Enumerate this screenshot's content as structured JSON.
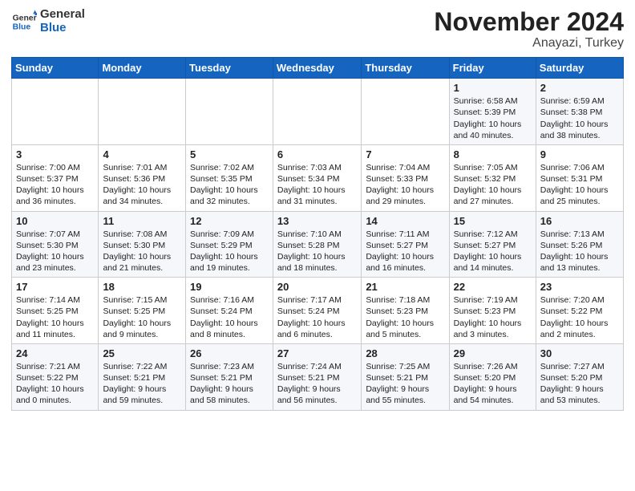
{
  "header": {
    "logo_general": "General",
    "logo_blue": "Blue",
    "title": "November 2024",
    "subtitle": "Anayazi, Turkey"
  },
  "days_of_week": [
    "Sunday",
    "Monday",
    "Tuesday",
    "Wednesday",
    "Thursday",
    "Friday",
    "Saturday"
  ],
  "weeks": [
    [
      {
        "day": "",
        "info": ""
      },
      {
        "day": "",
        "info": ""
      },
      {
        "day": "",
        "info": ""
      },
      {
        "day": "",
        "info": ""
      },
      {
        "day": "",
        "info": ""
      },
      {
        "day": "1",
        "info": "Sunrise: 6:58 AM\nSunset: 5:39 PM\nDaylight: 10 hours\nand 40 minutes."
      },
      {
        "day": "2",
        "info": "Sunrise: 6:59 AM\nSunset: 5:38 PM\nDaylight: 10 hours\nand 38 minutes."
      }
    ],
    [
      {
        "day": "3",
        "info": "Sunrise: 7:00 AM\nSunset: 5:37 PM\nDaylight: 10 hours\nand 36 minutes."
      },
      {
        "day": "4",
        "info": "Sunrise: 7:01 AM\nSunset: 5:36 PM\nDaylight: 10 hours\nand 34 minutes."
      },
      {
        "day": "5",
        "info": "Sunrise: 7:02 AM\nSunset: 5:35 PM\nDaylight: 10 hours\nand 32 minutes."
      },
      {
        "day": "6",
        "info": "Sunrise: 7:03 AM\nSunset: 5:34 PM\nDaylight: 10 hours\nand 31 minutes."
      },
      {
        "day": "7",
        "info": "Sunrise: 7:04 AM\nSunset: 5:33 PM\nDaylight: 10 hours\nand 29 minutes."
      },
      {
        "day": "8",
        "info": "Sunrise: 7:05 AM\nSunset: 5:32 PM\nDaylight: 10 hours\nand 27 minutes."
      },
      {
        "day": "9",
        "info": "Sunrise: 7:06 AM\nSunset: 5:31 PM\nDaylight: 10 hours\nand 25 minutes."
      }
    ],
    [
      {
        "day": "10",
        "info": "Sunrise: 7:07 AM\nSunset: 5:30 PM\nDaylight: 10 hours\nand 23 minutes."
      },
      {
        "day": "11",
        "info": "Sunrise: 7:08 AM\nSunset: 5:30 PM\nDaylight: 10 hours\nand 21 minutes."
      },
      {
        "day": "12",
        "info": "Sunrise: 7:09 AM\nSunset: 5:29 PM\nDaylight: 10 hours\nand 19 minutes."
      },
      {
        "day": "13",
        "info": "Sunrise: 7:10 AM\nSunset: 5:28 PM\nDaylight: 10 hours\nand 18 minutes."
      },
      {
        "day": "14",
        "info": "Sunrise: 7:11 AM\nSunset: 5:27 PM\nDaylight: 10 hours\nand 16 minutes."
      },
      {
        "day": "15",
        "info": "Sunrise: 7:12 AM\nSunset: 5:27 PM\nDaylight: 10 hours\nand 14 minutes."
      },
      {
        "day": "16",
        "info": "Sunrise: 7:13 AM\nSunset: 5:26 PM\nDaylight: 10 hours\nand 13 minutes."
      }
    ],
    [
      {
        "day": "17",
        "info": "Sunrise: 7:14 AM\nSunset: 5:25 PM\nDaylight: 10 hours\nand 11 minutes."
      },
      {
        "day": "18",
        "info": "Sunrise: 7:15 AM\nSunset: 5:25 PM\nDaylight: 10 hours\nand 9 minutes."
      },
      {
        "day": "19",
        "info": "Sunrise: 7:16 AM\nSunset: 5:24 PM\nDaylight: 10 hours\nand 8 minutes."
      },
      {
        "day": "20",
        "info": "Sunrise: 7:17 AM\nSunset: 5:24 PM\nDaylight: 10 hours\nand 6 minutes."
      },
      {
        "day": "21",
        "info": "Sunrise: 7:18 AM\nSunset: 5:23 PM\nDaylight: 10 hours\nand 5 minutes."
      },
      {
        "day": "22",
        "info": "Sunrise: 7:19 AM\nSunset: 5:23 PM\nDaylight: 10 hours\nand 3 minutes."
      },
      {
        "day": "23",
        "info": "Sunrise: 7:20 AM\nSunset: 5:22 PM\nDaylight: 10 hours\nand 2 minutes."
      }
    ],
    [
      {
        "day": "24",
        "info": "Sunrise: 7:21 AM\nSunset: 5:22 PM\nDaylight: 10 hours\nand 0 minutes."
      },
      {
        "day": "25",
        "info": "Sunrise: 7:22 AM\nSunset: 5:21 PM\nDaylight: 9 hours\nand 59 minutes."
      },
      {
        "day": "26",
        "info": "Sunrise: 7:23 AM\nSunset: 5:21 PM\nDaylight: 9 hours\nand 58 minutes."
      },
      {
        "day": "27",
        "info": "Sunrise: 7:24 AM\nSunset: 5:21 PM\nDaylight: 9 hours\nand 56 minutes."
      },
      {
        "day": "28",
        "info": "Sunrise: 7:25 AM\nSunset: 5:21 PM\nDaylight: 9 hours\nand 55 minutes."
      },
      {
        "day": "29",
        "info": "Sunrise: 7:26 AM\nSunset: 5:20 PM\nDaylight: 9 hours\nand 54 minutes."
      },
      {
        "day": "30",
        "info": "Sunrise: 7:27 AM\nSunset: 5:20 PM\nDaylight: 9 hours\nand 53 minutes."
      }
    ]
  ]
}
